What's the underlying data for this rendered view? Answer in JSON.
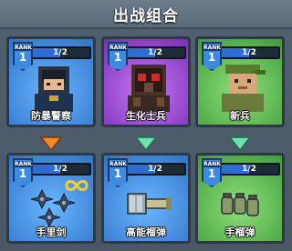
{
  "title": "出战组合",
  "rank_label": "RANK",
  "heroes": [
    {
      "name": "防暴警察",
      "rank": "1",
      "progress": "1/2",
      "progress_fraction": 0.5,
      "theme": "blue"
    },
    {
      "name": "生化士兵",
      "rank": "1",
      "progress": "1/2",
      "progress_fraction": 0.5,
      "theme": "purple"
    },
    {
      "name": "新兵",
      "rank": "1",
      "progress": "1/2",
      "progress_fraction": 0.5,
      "theme": "green"
    }
  ],
  "weapons": [
    {
      "name": "手里剑",
      "rank": "1",
      "progress": "1/2",
      "progress_fraction": 0.5,
      "theme": "blue",
      "extra_icon": "infinity-icon"
    },
    {
      "name": "高能榴弹",
      "rank": "1",
      "progress": "1/2",
      "progress_fraction": 0.5,
      "theme": "blue"
    },
    {
      "name": "手榴弹",
      "rank": "1",
      "progress": "1/2",
      "progress_fraction": 0.5,
      "theme": "green"
    }
  ],
  "arrows": [
    {
      "color": "#f08c2e",
      "icon": "down-arrow-icon"
    },
    {
      "color": "#6fe0b0",
      "icon": "down-arrow-icon"
    },
    {
      "color": "#6fe0b0",
      "icon": "down-arrow-icon"
    }
  ],
  "colors": {
    "blue": "#3f8cd8",
    "purple": "#9c45d4",
    "green": "#56c25a",
    "orange_arrow": "#f08c2e",
    "mint_arrow": "#6fe0b0"
  }
}
